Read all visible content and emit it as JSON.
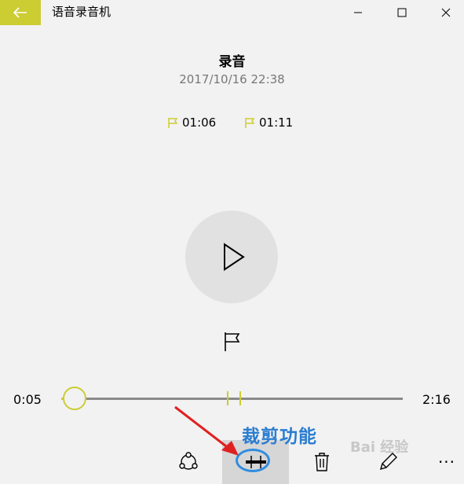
{
  "window": {
    "app_title": "语音录音机",
    "back_icon": "back-arrow-icon",
    "accent": "#cccc33"
  },
  "recording": {
    "title": "录音",
    "datetime": "2017/10/16 22:38"
  },
  "markers": [
    {
      "label": "01:06"
    },
    {
      "label": "01:11"
    }
  ],
  "playback": {
    "current_time": "0:05",
    "total_time": "2:16",
    "position_fraction": 0.04,
    "marker_fractions": [
      0.485,
      0.522
    ]
  },
  "toolbar": {
    "items": [
      {
        "name": "share",
        "icon": "share-icon"
      },
      {
        "name": "trim",
        "icon": "trim-icon",
        "selected": true
      },
      {
        "name": "delete",
        "icon": "trash-icon"
      },
      {
        "name": "rename",
        "icon": "pencil-icon"
      },
      {
        "name": "more",
        "label": "···"
      }
    ]
  },
  "annotation": {
    "label": "裁剪功能",
    "color": "#2a7dd0",
    "arrow_color": "#e02020"
  },
  "watermark": {
    "text": "Bai 经验"
  }
}
